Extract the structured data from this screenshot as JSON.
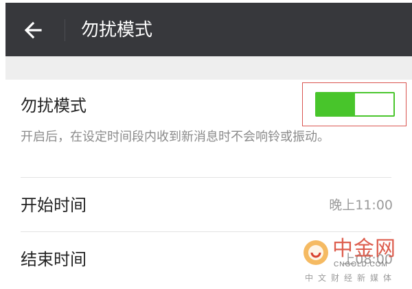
{
  "header": {
    "title": "勿扰模式",
    "back_icon": "arrow-left-icon",
    "background_color": "#37383c"
  },
  "dnd": {
    "label": "勿扰模式",
    "description": "开启后，在设定时间段内收到新消息时不会响铃或振动。",
    "toggle": {
      "on": true,
      "accent_color": "#48c52b",
      "fill_fraction": 0.5
    },
    "highlight_color": "#d9534f"
  },
  "schedule": {
    "start_label": "开始时间",
    "start_value": "晚上11:00",
    "end_label": "结束时间",
    "end_value": "上08:00"
  },
  "watermark": {
    "brand": "中金网",
    "domain": "CNGOLD.COM",
    "tagline": "中文财经新媒体"
  }
}
